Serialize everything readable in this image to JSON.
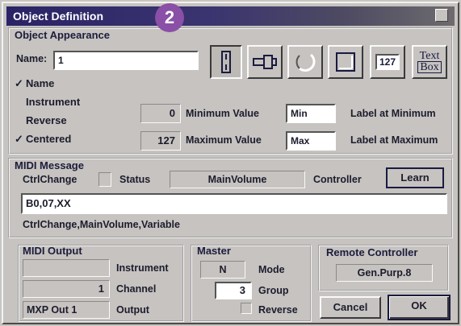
{
  "window": {
    "title": "Object Definition",
    "step_badge": "2"
  },
  "appearance": {
    "heading": "Object Appearance",
    "name_label": "Name:",
    "name_value": "1",
    "checkboxes": [
      {
        "label": "Name",
        "checked": true,
        "mark": "✓"
      },
      {
        "label": "Instrument",
        "checked": false,
        "mark": ""
      },
      {
        "label": "Reverse",
        "checked": false,
        "mark": ""
      },
      {
        "label": "Centered",
        "checked": true,
        "mark": "✓"
      }
    ],
    "type_buttons": [
      {
        "name": "slider-type-button",
        "icon": "slider-icon",
        "pressed": true
      },
      {
        "name": "fader-type-button",
        "icon": "fader-icon",
        "pressed": false
      },
      {
        "name": "knob-type-button",
        "icon": "knob-icon",
        "pressed": false
      },
      {
        "name": "pad-type-button",
        "icon": "pad-icon",
        "pressed": false
      },
      {
        "name": "number-type-button",
        "icon": "number-icon",
        "text": "127",
        "pressed": false
      },
      {
        "name": "textbox-type-button",
        "icon": "textbox-icon",
        "text_line1": "Text",
        "text_line2": "Box",
        "pressed": false
      }
    ],
    "min_value": "0",
    "min_value_label": "Minimum Value",
    "min_label_value": "Min",
    "label_at_min": "Label at Minimum",
    "max_value": "127",
    "max_value_label": "Maximum Value",
    "max_label_value": "Max",
    "label_at_max": "Label at Maximum"
  },
  "midi_message": {
    "heading": "MIDI Message",
    "type_value": "CtrlChange",
    "status_label": "Status",
    "controller_value": "MainVolume",
    "controller_label": "Controller",
    "learn_label": "Learn",
    "hex_value": "B0,07,XX",
    "description": "CtrlChange,MainVolume,Variable"
  },
  "midi_output": {
    "heading": "MIDI Output",
    "instrument_value": "",
    "instrument_label": "Instrument",
    "channel_value": "1",
    "channel_label": "Channel",
    "output_value": "MXP Out 1",
    "output_label": "Output"
  },
  "master": {
    "heading": "Master",
    "mode_value": "N",
    "mode_label": "Mode",
    "group_value": "3",
    "group_label": "Group",
    "reverse_label": "Reverse"
  },
  "remote": {
    "heading": "Remote Controller",
    "value": "Gen.Purp.8"
  },
  "buttons": {
    "cancel": "Cancel",
    "ok": "OK"
  },
  "colors": {
    "title_bar": "#2a2466",
    "badge": "#8a4fa6",
    "dialog": "#c6c3c0"
  }
}
